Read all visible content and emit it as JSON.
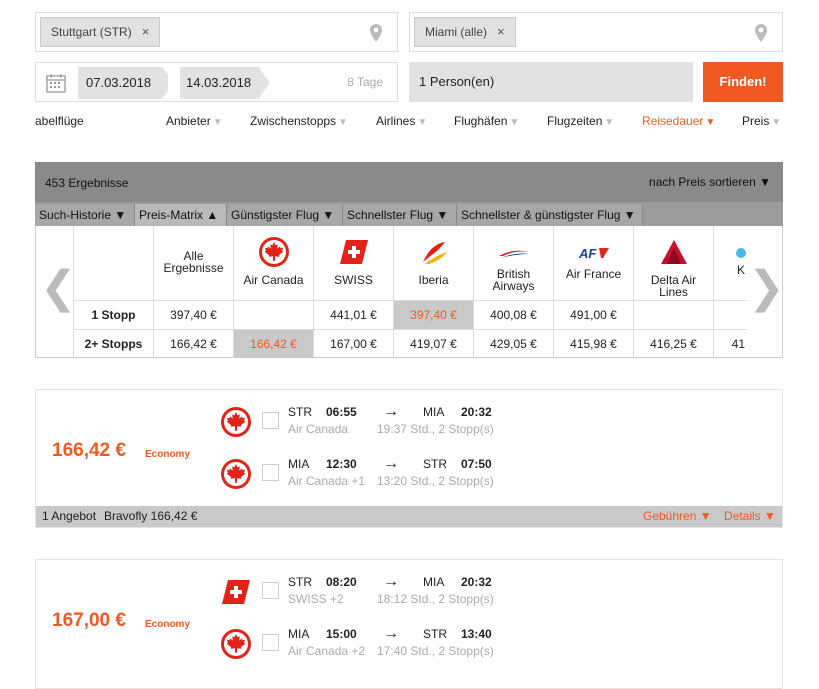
{
  "search": {
    "origin": "Stuttgart (STR)",
    "destination": "Miami (alle)",
    "depart": "07.03.2018",
    "return": "14.03.2018",
    "days": "8 Tage",
    "persons": "1 Person(en)",
    "find_label": "Finden!",
    "remove_glyph": "×"
  },
  "filters": [
    {
      "label": "abelflüge"
    },
    {
      "label": "Anbieter"
    },
    {
      "label": "Zwischenstopps"
    },
    {
      "label": "Airlines"
    },
    {
      "label": "Flughäfen"
    },
    {
      "label": "Flugzeiten"
    },
    {
      "label": "Reisedauer"
    },
    {
      "label": "Preis"
    }
  ],
  "matrix": {
    "count": "453 Ergebnisse",
    "sort": "nach Preis sortieren",
    "tabs": [
      "Such-Historie",
      "Preis-Matrix ▲",
      "Günstigster Flug",
      "Schnellster Flug",
      "Schnellster & günstigster Flug"
    ],
    "row_labels": [
      "1 Stopp",
      "2+ Stopps"
    ],
    "all_label": "Alle Ergebnisse",
    "all_values": [
      "397,40 €",
      "166,42 €"
    ],
    "airlines": [
      {
        "name": "Air Canada",
        "stop1": "",
        "stop2": "166,42 €"
      },
      {
        "name": "SWISS",
        "stop1": "441,01 €",
        "stop2": "167,00 €"
      },
      {
        "name": "Iberia",
        "stop1": "397,40 €",
        "stop2": "419,07 €"
      },
      {
        "name": "British Airways",
        "stop1": "400,08 €",
        "stop2": "429,05 €"
      },
      {
        "name": "Air France",
        "stop1": "491,00 €",
        "stop2": "415,98 €"
      },
      {
        "name": "Delta Air Lines",
        "stop1": "",
        "stop2": "416,25 €"
      },
      {
        "name": "K",
        "stop1": "",
        "stop2": "41"
      }
    ],
    "prev_glyph": "❮",
    "next_glyph": "❯"
  },
  "results": [
    {
      "price": "166,42 €",
      "cabin": "Economy",
      "legs": [
        {
          "from": "STR",
          "dep": "06:55",
          "to": "MIA",
          "arr": "20:32",
          "airline": "Air Canada",
          "info": "19:37 Std., 2 Stopp(s)"
        },
        {
          "from": "MIA",
          "dep": "12:30",
          "to": "STR",
          "arr": "07:50",
          "airline": "Air Canada +1",
          "info": "13:20 Std., 2 Stopp(s)"
        }
      ],
      "offers": "1 Angebot",
      "provider": "Bravofly 166,42 €",
      "fees": "Gebühren ▼",
      "details": "Details ▼"
    },
    {
      "price": "167,00 €",
      "cabin": "Economy",
      "legs": [
        {
          "from": "STR",
          "dep": "08:20",
          "to": "MIA",
          "arr": "20:32",
          "airline": "SWISS +2",
          "info": "18:12 Std., 2 Stopp(s)"
        },
        {
          "from": "MIA",
          "dep": "15:00",
          "to": "STR",
          "arr": "13:40",
          "airline": "Air Canada +2",
          "info": "17:40 Std., 2 Stopp(s)"
        }
      ]
    }
  ],
  "arrow_glyph": "→",
  "filter_tri": "▼",
  "accent": "#f05a22"
}
